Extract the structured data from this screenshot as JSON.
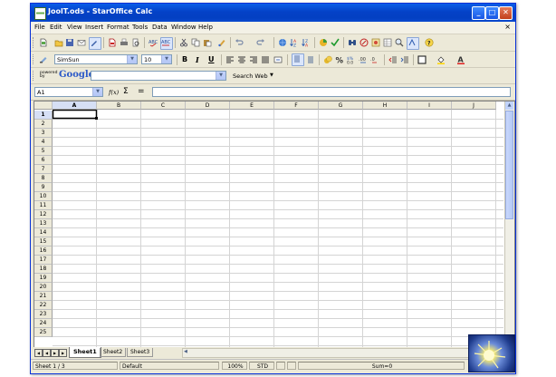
{
  "window": {
    "title": "JoolT.ods - StarOffice Calc",
    "minimize": "_",
    "maximize": "□",
    "close": "✕"
  },
  "menu": [
    "File",
    "Edit",
    "View",
    "Insert",
    "Format",
    "Tools",
    "Data",
    "Window",
    "Help"
  ],
  "doc_close": "×",
  "format_bar": {
    "font_name": "SimSun",
    "font_size": "10",
    "bold": "B",
    "italic": "I",
    "underline": "U"
  },
  "google_bar": {
    "powered": "powered by",
    "brand": "Google",
    "search_value": "",
    "search_button": "Search Web"
  },
  "formula_bar": {
    "name_box": "A1",
    "function_icon": "f(x)",
    "sum_icon": "Σ",
    "equals_icon": "=",
    "formula_value": ""
  },
  "columns": [
    "A",
    "B",
    "C",
    "D",
    "E",
    "F",
    "G",
    "H",
    "I",
    "J"
  ],
  "rows": [
    "1",
    "2",
    "3",
    "4",
    "5",
    "6",
    "7",
    "8",
    "9",
    "10",
    "11",
    "12",
    "13",
    "14",
    "15",
    "16",
    "17",
    "18",
    "19",
    "20",
    "21",
    "22",
    "23",
    "24",
    "25"
  ],
  "selected_cell": "A1",
  "sheet_tabs": [
    "Sheet1",
    "Sheet2",
    "Sheet3"
  ],
  "active_sheet": "Sheet1",
  "status": {
    "sheet": "Sheet 1 / 3",
    "style": "Default",
    "zoom": "100%",
    "mode": "STD",
    "sum": "Sum=0"
  }
}
